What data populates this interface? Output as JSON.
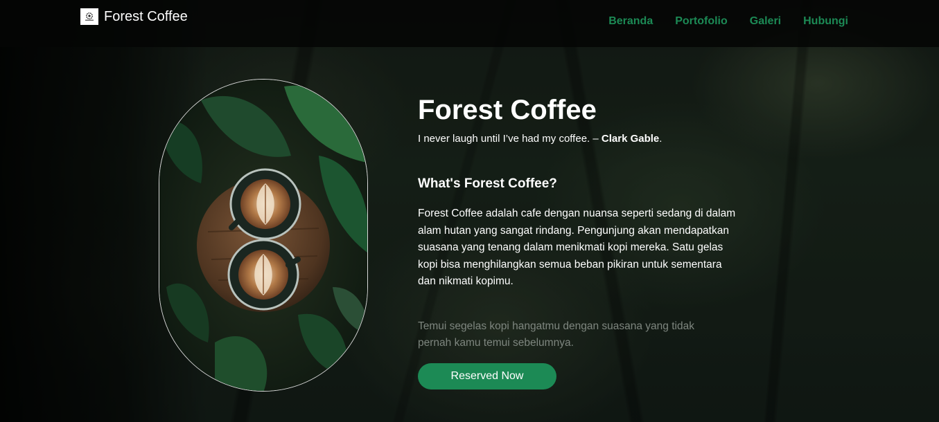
{
  "navbar": {
    "brand_name": "Forest Coffee",
    "logo_icon": "coffee-bean-logo",
    "links": [
      "Beranda",
      "Portofolio",
      "Galeri",
      "Hubungi"
    ],
    "link_color": "#1c8a55"
  },
  "hero": {
    "image_alt": "Two latte art coffees on a wooden table surrounded by leaves",
    "title": "Forest Coffee",
    "quote_text": "I never laugh until I’ve had my coffee. –",
    "quote_author": "Clark Gable",
    "quote_end": ".",
    "what_prefix": "What's",
    "what_bold": "Forest Coffee?",
    "description": "Forest Coffee adalah cafe dengan nuansa seperti sedang di dalam alam hutan yang sangat rindang. Pengunjung akan mendapatkan suasana yang tenang dalam menikmati kopi mereka. Satu gelas kopi bisa menghilangkan semua beban pikiran untuk sementara dan nikmati kopimu.",
    "tagline": "Temui segelas kopi hangatmu dengan suasana yang tidak pernah kamu temui sebelumnya.",
    "cta_label": "Reserved Now",
    "accent_color": "#1c8a55"
  }
}
